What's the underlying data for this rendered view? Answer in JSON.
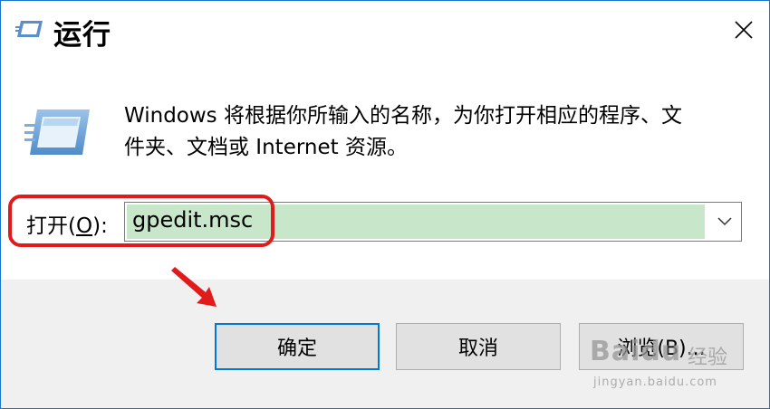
{
  "window": {
    "title": "运行",
    "close_icon": "close-icon"
  },
  "prompt": {
    "description_line1": "Windows 将根据你所输入的名称，为你打开相应的程序、文",
    "description_line2": "件夹、文档或 Internet 资源。",
    "icon": "run-dialog-icon"
  },
  "open": {
    "label_prefix": "打开(",
    "label_mnemonic": "O",
    "label_suffix": "):",
    "value": "gpedit.msc",
    "dropdown_icon": "chevron-down-icon"
  },
  "buttons": {
    "ok": "确定",
    "cancel": "取消",
    "browse": "浏览(B)..."
  },
  "watermark": {
    "brand": "Baidu",
    "brand_cn": "经验",
    "url": "jingyan.baidu.com"
  },
  "colors": {
    "highlight": "#e11b1b",
    "selection": "#c8e6c9",
    "accent": "#0078d7"
  }
}
